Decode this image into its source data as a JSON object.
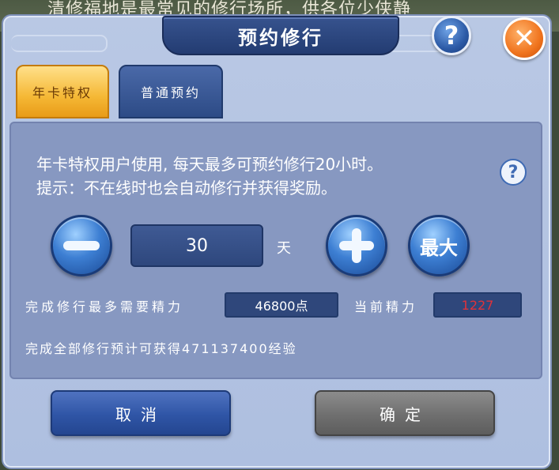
{
  "background_text": "清修福地是最常见的修行场所，供各位少侠静",
  "dialog": {
    "title": "预约修行",
    "help_glyph": "?",
    "close_glyph": "✕"
  },
  "tabs": [
    {
      "label": "年卡特权",
      "active": true
    },
    {
      "label": "普通预约",
      "active": false
    }
  ],
  "notice": {
    "line1": "年卡特权用户使用, 每天最多可预约修行20小时。",
    "line2": "提示：不在线时也会自动修行并获得奖励。",
    "help_glyph": "?"
  },
  "quantity": {
    "value": "30",
    "unit": "天",
    "max_label": "最大"
  },
  "energy": {
    "required_label": "完成修行最多需要精力",
    "required_value": "46800点",
    "current_label": "当前精力",
    "current_value": "1227",
    "current_color": "#e0323a"
  },
  "reward_text": "完成全部修行预计可获得471137400经验",
  "buttons": {
    "cancel": "取消",
    "confirm": "确定"
  }
}
